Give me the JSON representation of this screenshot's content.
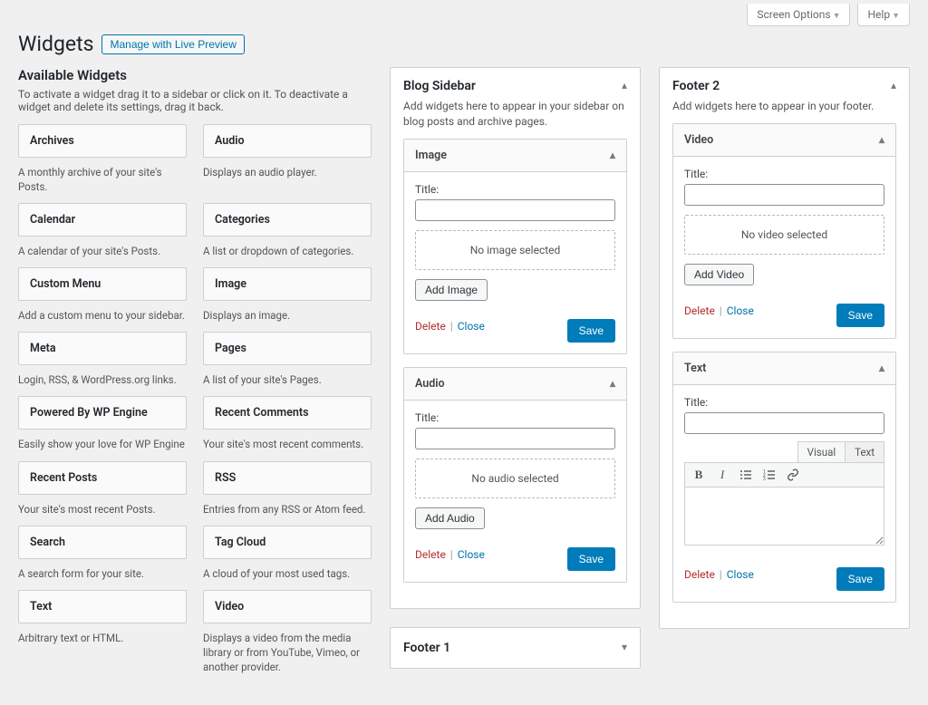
{
  "screen_tabs": {
    "screen_options": "Screen Options",
    "help": "Help"
  },
  "page_title": "Widgets",
  "live_preview_button": "Manage with Live Preview",
  "available": {
    "heading": "Available Widgets",
    "desc": "To activate a widget drag it to a sidebar or click on it. To deactivate a widget and delete its settings, drag it back.",
    "items": [
      {
        "name": "Archives",
        "desc": "A monthly archive of your site's Posts."
      },
      {
        "name": "Audio",
        "desc": "Displays an audio player."
      },
      {
        "name": "Calendar",
        "desc": "A calendar of your site's Posts."
      },
      {
        "name": "Categories",
        "desc": "A list or dropdown of categories."
      },
      {
        "name": "Custom Menu",
        "desc": "Add a custom menu to your sidebar."
      },
      {
        "name": "Image",
        "desc": "Displays an image."
      },
      {
        "name": "Meta",
        "desc": "Login, RSS, & WordPress.org links."
      },
      {
        "name": "Pages",
        "desc": "A list of your site's Pages."
      },
      {
        "name": "Powered By WP Engine",
        "desc": "Easily show your love for WP Engine"
      },
      {
        "name": "Recent Comments",
        "desc": "Your site's most recent comments."
      },
      {
        "name": "Recent Posts",
        "desc": "Your site's most recent Posts."
      },
      {
        "name": "RSS",
        "desc": "Entries from any RSS or Atom feed."
      },
      {
        "name": "Search",
        "desc": "A search form for your site."
      },
      {
        "name": "Tag Cloud",
        "desc": "A cloud of your most used tags."
      },
      {
        "name": "Text",
        "desc": "Arbitrary text or HTML."
      },
      {
        "name": "Video",
        "desc": "Displays a video from the media library or from YouTube, Vimeo, or another provider."
      }
    ]
  },
  "common": {
    "title_label": "Title:",
    "delete": "Delete",
    "close": "Close",
    "save": "Save"
  },
  "blog_sidebar": {
    "title": "Blog Sidebar",
    "desc": "Add widgets here to appear in your sidebar on blog posts and archive pages.",
    "image": {
      "heading": "Image",
      "placeholder": "No image selected",
      "add_button": "Add Image"
    },
    "audio": {
      "heading": "Audio",
      "placeholder": "No audio selected",
      "add_button": "Add Audio"
    }
  },
  "footer1": {
    "title": "Footer 1"
  },
  "footer2": {
    "title": "Footer 2",
    "desc": "Add widgets here to appear in your footer.",
    "video": {
      "heading": "Video",
      "placeholder": "No video selected",
      "add_button": "Add Video"
    },
    "text": {
      "heading": "Text",
      "tab_visual": "Visual",
      "tab_text": "Text"
    }
  }
}
